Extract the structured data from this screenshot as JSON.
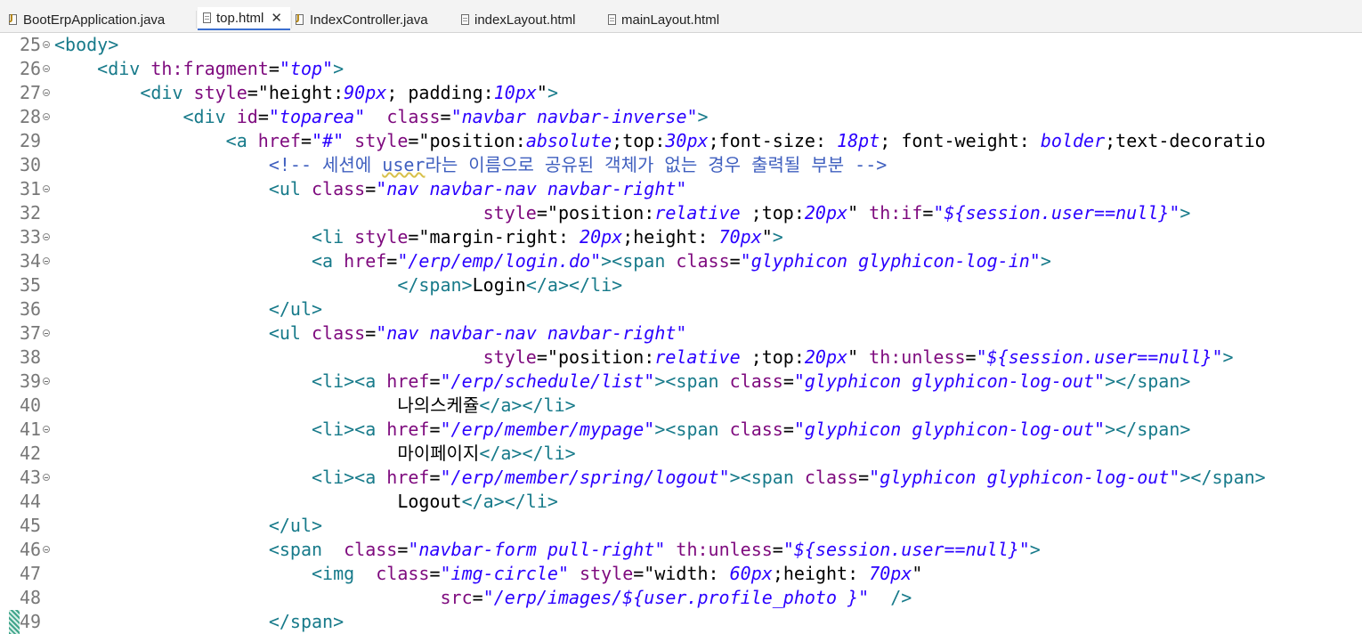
{
  "tabs": [
    {
      "label": "BootErpApplication.java",
      "icon": "java-file-icon",
      "active": false
    },
    {
      "label": "top.html",
      "icon": "html-file-icon",
      "active": true
    },
    {
      "label": "IndexController.java",
      "icon": "java-file-icon",
      "active": false
    },
    {
      "label": "indexLayout.html",
      "icon": "html-file-icon",
      "active": false
    },
    {
      "label": "mainLayout.html",
      "icon": "html-file-icon",
      "active": false
    }
  ],
  "close_glyph": "✕",
  "editor": {
    "lines": [
      {
        "num": "25",
        "fold": true,
        "indent": "",
        "tokens": [
          {
            "k": "t",
            "s": "<body>"
          }
        ]
      },
      {
        "num": "26",
        "fold": true,
        "indent": "    ",
        "tokens": [
          {
            "k": "t",
            "s": "<div "
          },
          {
            "k": "a",
            "s": "th:fragment"
          },
          {
            "k": "q",
            "s": "="
          },
          {
            "k": "v",
            "s": "\"top\""
          },
          {
            "k": "t",
            "s": ">"
          }
        ]
      },
      {
        "num": "27",
        "fold": true,
        "indent": "        ",
        "tokens": [
          {
            "k": "t",
            "s": "<div "
          },
          {
            "k": "a",
            "s": "style"
          },
          {
            "k": "q",
            "s": "=\"height:"
          },
          {
            "k": "v",
            "s": "90px"
          },
          {
            "k": "q",
            "s": "; padding:"
          },
          {
            "k": "v",
            "s": "10px"
          },
          {
            "k": "q",
            "s": "\""
          },
          {
            "k": "t",
            "s": ">"
          }
        ]
      },
      {
        "num": "28",
        "fold": true,
        "indent": "            ",
        "tokens": [
          {
            "k": "t",
            "s": "<div "
          },
          {
            "k": "a",
            "s": "id"
          },
          {
            "k": "q",
            "s": "="
          },
          {
            "k": "v",
            "s": "\"toparea\""
          },
          {
            "k": "q",
            "s": "  "
          },
          {
            "k": "a",
            "s": "class"
          },
          {
            "k": "q",
            "s": "="
          },
          {
            "k": "v",
            "s": "\"navbar navbar-inverse\""
          },
          {
            "k": "t",
            "s": ">"
          }
        ]
      },
      {
        "num": "29",
        "fold": false,
        "indent": "                ",
        "tokens": [
          {
            "k": "t",
            "s": "<a "
          },
          {
            "k": "a",
            "s": "href"
          },
          {
            "k": "q",
            "s": "="
          },
          {
            "k": "v",
            "s": "\"#\""
          },
          {
            "k": "q",
            "s": " "
          },
          {
            "k": "a",
            "s": "style"
          },
          {
            "k": "q",
            "s": "=\"position:"
          },
          {
            "k": "v",
            "s": "absolute"
          },
          {
            "k": "q",
            "s": ";top:"
          },
          {
            "k": "v",
            "s": "30px"
          },
          {
            "k": "q",
            "s": ";font-size: "
          },
          {
            "k": "v",
            "s": "18pt"
          },
          {
            "k": "q",
            "s": "; font-weight: "
          },
          {
            "k": "v",
            "s": "bolder"
          },
          {
            "k": "q",
            "s": ";text-decoratio"
          }
        ]
      },
      {
        "num": "30",
        "fold": false,
        "indent": "                    ",
        "tokens": [
          {
            "k": "c",
            "s": "<!-- 세션에 "
          },
          {
            "k": "cu",
            "s": "user"
          },
          {
            "k": "c",
            "s": "라는 이름으로 공유된 객체가 없는 경우 출력될 부분 -->"
          }
        ]
      },
      {
        "num": "31",
        "fold": true,
        "indent": "                    ",
        "tokens": [
          {
            "k": "t",
            "s": "<ul "
          },
          {
            "k": "a",
            "s": "class"
          },
          {
            "k": "q",
            "s": "="
          },
          {
            "k": "v",
            "s": "\"nav navbar-nav navbar-right\""
          }
        ]
      },
      {
        "num": "32",
        "fold": false,
        "indent": "                                        ",
        "tokens": [
          {
            "k": "a",
            "s": "style"
          },
          {
            "k": "q",
            "s": "=\"position:"
          },
          {
            "k": "v",
            "s": "relative"
          },
          {
            "k": "q",
            "s": " ;top:"
          },
          {
            "k": "v",
            "s": "20px"
          },
          {
            "k": "q",
            "s": "\" "
          },
          {
            "k": "a",
            "s": "th:if"
          },
          {
            "k": "q",
            "s": "="
          },
          {
            "k": "v",
            "s": "\"${session.user==null}\""
          },
          {
            "k": "t",
            "s": ">"
          }
        ]
      },
      {
        "num": "33",
        "fold": true,
        "indent": "                        ",
        "tokens": [
          {
            "k": "t",
            "s": "<li "
          },
          {
            "k": "a",
            "s": "style"
          },
          {
            "k": "q",
            "s": "=\"margin-right: "
          },
          {
            "k": "v",
            "s": "20px"
          },
          {
            "k": "q",
            "s": ";height: "
          },
          {
            "k": "v",
            "s": "70px"
          },
          {
            "k": "q",
            "s": "\""
          },
          {
            "k": "t",
            "s": ">"
          }
        ]
      },
      {
        "num": "34",
        "fold": true,
        "indent": "                        ",
        "tokens": [
          {
            "k": "t",
            "s": "<a "
          },
          {
            "k": "a",
            "s": "href"
          },
          {
            "k": "q",
            "s": "="
          },
          {
            "k": "v",
            "s": "\"/erp/emp/login.do\""
          },
          {
            "k": "t",
            "s": "><span "
          },
          {
            "k": "a",
            "s": "class"
          },
          {
            "k": "q",
            "s": "="
          },
          {
            "k": "v",
            "s": "\"glyphicon glyphicon-log-in\""
          },
          {
            "k": "t",
            "s": ">"
          }
        ]
      },
      {
        "num": "35",
        "fold": false,
        "indent": "                                ",
        "tokens": [
          {
            "k": "t",
            "s": "</span>"
          },
          {
            "k": "p",
            "s": "Login"
          },
          {
            "k": "t",
            "s": "</a></li>"
          }
        ]
      },
      {
        "num": "36",
        "fold": false,
        "indent": "                    ",
        "tokens": [
          {
            "k": "t",
            "s": "</ul>"
          }
        ]
      },
      {
        "num": "37",
        "fold": true,
        "indent": "                    ",
        "tokens": [
          {
            "k": "t",
            "s": "<ul "
          },
          {
            "k": "a",
            "s": "class"
          },
          {
            "k": "q",
            "s": "="
          },
          {
            "k": "v",
            "s": "\"nav navbar-nav navbar-right\""
          }
        ]
      },
      {
        "num": "38",
        "fold": false,
        "indent": "                                        ",
        "tokens": [
          {
            "k": "a",
            "s": "style"
          },
          {
            "k": "q",
            "s": "=\"position:"
          },
          {
            "k": "v",
            "s": "relative"
          },
          {
            "k": "q",
            "s": " ;top:"
          },
          {
            "k": "v",
            "s": "20px"
          },
          {
            "k": "q",
            "s": "\" "
          },
          {
            "k": "a",
            "s": "th:unless"
          },
          {
            "k": "q",
            "s": "="
          },
          {
            "k": "v",
            "s": "\"${session.user==null}\""
          },
          {
            "k": "t",
            "s": ">"
          }
        ]
      },
      {
        "num": "39",
        "fold": true,
        "indent": "                        ",
        "tokens": [
          {
            "k": "t",
            "s": "<li><a "
          },
          {
            "k": "a",
            "s": "href"
          },
          {
            "k": "q",
            "s": "="
          },
          {
            "k": "v",
            "s": "\"/erp/schedule/list\""
          },
          {
            "k": "t",
            "s": "><span "
          },
          {
            "k": "a",
            "s": "class"
          },
          {
            "k": "q",
            "s": "="
          },
          {
            "k": "v",
            "s": "\"glyphicon glyphicon-log-out\""
          },
          {
            "k": "t",
            "s": "></span>"
          }
        ]
      },
      {
        "num": "40",
        "fold": false,
        "indent": "                                ",
        "tokens": [
          {
            "k": "p",
            "s": "나의스케쥴"
          },
          {
            "k": "t",
            "s": "</a></li>"
          }
        ]
      },
      {
        "num": "41",
        "fold": true,
        "indent": "                        ",
        "tokens": [
          {
            "k": "t",
            "s": "<li><a "
          },
          {
            "k": "a",
            "s": "href"
          },
          {
            "k": "q",
            "s": "="
          },
          {
            "k": "v",
            "s": "\"/erp/member/mypage\""
          },
          {
            "k": "t",
            "s": "><span "
          },
          {
            "k": "a",
            "s": "class"
          },
          {
            "k": "q",
            "s": "="
          },
          {
            "k": "v",
            "s": "\"glyphicon glyphicon-log-out\""
          },
          {
            "k": "t",
            "s": "></span>"
          }
        ]
      },
      {
        "num": "42",
        "fold": false,
        "indent": "                                ",
        "tokens": [
          {
            "k": "p",
            "s": "마이페이지"
          },
          {
            "k": "t",
            "s": "</a></li>"
          }
        ]
      },
      {
        "num": "43",
        "fold": true,
        "indent": "                        ",
        "tokens": [
          {
            "k": "t",
            "s": "<li><a "
          },
          {
            "k": "a",
            "s": "href"
          },
          {
            "k": "q",
            "s": "="
          },
          {
            "k": "v",
            "s": "\"/erp/member/spring/logout\""
          },
          {
            "k": "t",
            "s": "><span "
          },
          {
            "k": "a",
            "s": "class"
          },
          {
            "k": "q",
            "s": "="
          },
          {
            "k": "v",
            "s": "\"glyphicon glyphicon-log-out\""
          },
          {
            "k": "t",
            "s": "></span>"
          }
        ]
      },
      {
        "num": "44",
        "fold": false,
        "indent": "                                ",
        "tokens": [
          {
            "k": "p",
            "s": "Logout"
          },
          {
            "k": "t",
            "s": "</a></li>"
          }
        ]
      },
      {
        "num": "45",
        "fold": false,
        "indent": "                    ",
        "tokens": [
          {
            "k": "t",
            "s": "</ul>"
          }
        ]
      },
      {
        "num": "46",
        "fold": true,
        "indent": "                    ",
        "tokens": [
          {
            "k": "t",
            "s": "<span  "
          },
          {
            "k": "a",
            "s": "class"
          },
          {
            "k": "q",
            "s": "="
          },
          {
            "k": "v",
            "s": "\"navbar-form pull-right\""
          },
          {
            "k": "q",
            "s": " "
          },
          {
            "k": "a",
            "s": "th:unless"
          },
          {
            "k": "q",
            "s": "="
          },
          {
            "k": "v",
            "s": "\"${session.user==null}\""
          },
          {
            "k": "t",
            "s": ">"
          }
        ]
      },
      {
        "num": "47",
        "fold": false,
        "indent": "                        ",
        "tokens": [
          {
            "k": "t",
            "s": "<img  "
          },
          {
            "k": "a",
            "s": "class"
          },
          {
            "k": "q",
            "s": "="
          },
          {
            "k": "v",
            "s": "\"img-circle\""
          },
          {
            "k": "q",
            "s": " "
          },
          {
            "k": "a",
            "s": "style"
          },
          {
            "k": "q",
            "s": "=\"width: "
          },
          {
            "k": "v",
            "s": "60px"
          },
          {
            "k": "q",
            "s": ";height: "
          },
          {
            "k": "v",
            "s": "70px"
          },
          {
            "k": "q",
            "s": "\""
          }
        ]
      },
      {
        "num": "48",
        "fold": false,
        "indent": "                                    ",
        "tokens": [
          {
            "k": "a",
            "s": "src"
          },
          {
            "k": "q",
            "s": "="
          },
          {
            "k": "v",
            "s": "\"/erp/images/${user.profile_photo }\""
          },
          {
            "k": "q",
            "s": "  "
          },
          {
            "k": "t",
            "s": "/>"
          }
        ]
      },
      {
        "num": "49",
        "fold": false,
        "indent": "                    ",
        "tokens": [
          {
            "k": "t",
            "s": "</span>"
          }
        ]
      }
    ]
  }
}
